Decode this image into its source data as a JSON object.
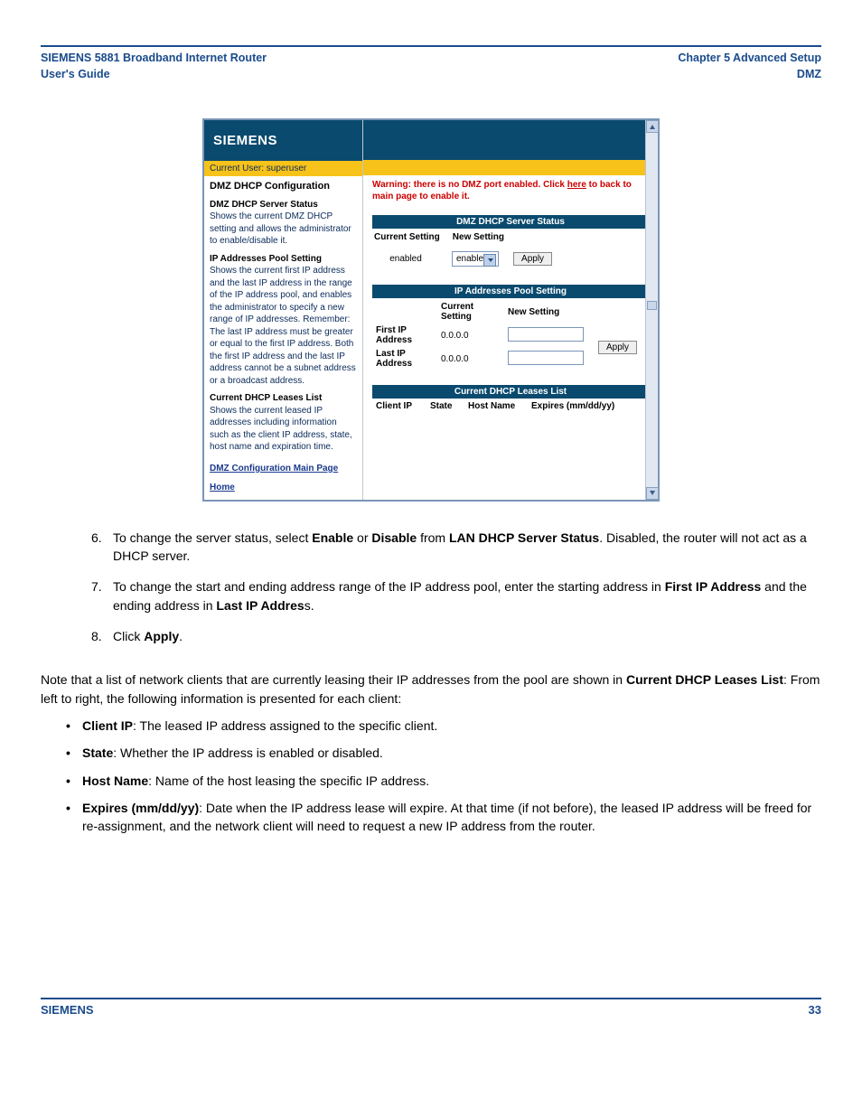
{
  "header": {
    "left_line1": "SIEMENS 5881 Broadband Internet Router",
    "left_line2": "User's Guide",
    "right_line1": "Chapter 5  Advanced Setup",
    "right_line2": "DMZ"
  },
  "app": {
    "brand": "SIEMENS",
    "user_bar": "Current User: superuser",
    "left_panel": {
      "title": "DMZ DHCP Configuration",
      "h1": "DMZ DHCP Server Status",
      "p1": "Shows the current DMZ DHCP setting and allows the administrator to enable/disable it.",
      "h2": "IP Addresses Pool Setting",
      "p2": "Shows the current first IP address and the last IP address in the range of the IP address pool, and enables the administrator to specify a new range of IP addresses. Remember: The last IP address must be greater or equal to the first IP address. Both the first IP address and the last IP address cannot be a subnet address or a broadcast address.",
      "h3": "Current DHCP Leases List",
      "p3": "Shows the current leased IP addresses including information such as the client IP address, state, host name and expiration time.",
      "link1": "DMZ Configuration Main Page",
      "link2": "Home"
    },
    "right_panel": {
      "warning_part1": "Warning: there is no DMZ port enabled. Click ",
      "warning_link": "here",
      "warning_part2": " to back to main page to enable it.",
      "status": {
        "title": "DMZ DHCP Server Status",
        "col1": "Current Setting",
        "col2": "New Setting",
        "value": "enabled",
        "select": "enable",
        "apply": "Apply"
      },
      "pool": {
        "title": "IP Addresses Pool Setting",
        "col_current": "Current Setting",
        "col_new": "New Setting",
        "first_label": "First IP Address",
        "first_value": "0.0.0.0",
        "last_label": "Last IP Address",
        "last_value": "0.0.0.0",
        "apply": "Apply"
      },
      "leases": {
        "title": "Current DHCP Leases List",
        "c1": "Client IP",
        "c2": "State",
        "c3": "Host Name",
        "c4": "Expires (mm/dd/yy)"
      }
    }
  },
  "steps": {
    "s6_pre": "To change the server status, select ",
    "s6_b1": "Enable",
    "s6_mid1": " or ",
    "s6_b2": "Disable",
    "s6_mid2": " from ",
    "s6_b3": "LAN DHCP Server Status",
    "s6_post": ". Disabled, the router will not act as a DHCP server.",
    "s7_pre": "To change the start and ending address range of the IP address pool, enter the starting address in ",
    "s7_b1": "First IP Address",
    "s7_mid": " and the ending address in ",
    "s7_b2": "Last IP Addres",
    "s7_post": "s.",
    "s8_pre": "Click ",
    "s8_b1": "Apply",
    "s8_post": ".",
    "n6": "6.",
    "n7": "7.",
    "n8": "8."
  },
  "note": {
    "pre": "Note that a list of network clients that are currently leasing their IP addresses from the pool are shown in ",
    "b": "Current DHCP Leases List",
    "post": ": From left to right, the following information is presented for each client:"
  },
  "bullets": {
    "b1_b": "Client IP",
    "b1_t": ": The leased IP address assigned to the specific client.",
    "b2_b": "State",
    "b2_t": ": Whether the IP address is enabled or disabled.",
    "b3_b": "Host Name",
    "b3_t": ": Name of the host leasing the specific IP address.",
    "b4_b": "Expires (mm/dd/yy)",
    "b4_t": ": Date when the IP address lease will expire. At that time (if not before), the leased IP address will be freed for re-assignment, and the network client will need to request a new IP address from the router."
  },
  "footer": {
    "brand": "SIEMENS",
    "page": "33"
  }
}
